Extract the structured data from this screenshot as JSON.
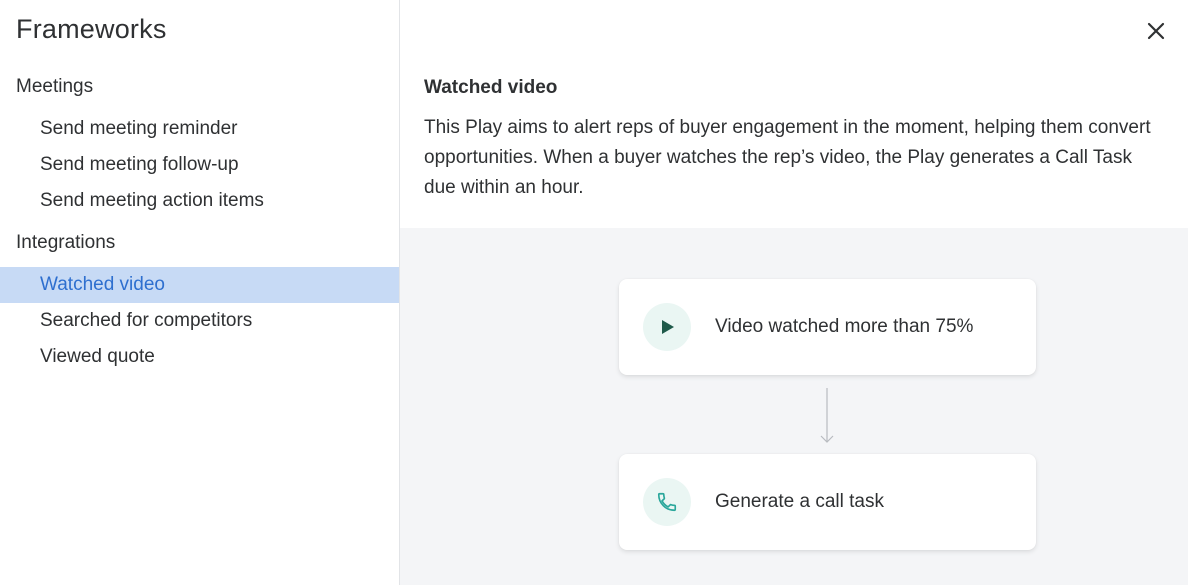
{
  "sidebar": {
    "title": "Frameworks",
    "sections": [
      {
        "header": "Meetings",
        "items": [
          {
            "label": "Send meeting reminder"
          },
          {
            "label": "Send meeting follow-up"
          },
          {
            "label": "Send meeting action items"
          }
        ]
      },
      {
        "header": "Integrations",
        "items": [
          {
            "label": "Watched video",
            "active": true
          },
          {
            "label": "Searched for competitors"
          },
          {
            "label": "Viewed quote"
          }
        ]
      }
    ]
  },
  "main": {
    "close_icon": "close-icon",
    "title": "Watched video",
    "description": "This Play aims to alert reps of buyer engagement in the moment, helping them convert opportunities. When a buyer watches the rep’s video, the Play generates a Call Task due within an hour.",
    "flow": [
      {
        "icon": "play-icon",
        "label": "Video watched more than 75%",
        "icon_color": "#1f5a4a"
      },
      {
        "icon": "phone-icon",
        "label": "Generate a call task",
        "icon_color": "#2aa79b"
      }
    ]
  },
  "colors": {
    "active_bg": "#c7daf5",
    "active_text": "#2e6fcf",
    "canvas_bg": "#f4f5f7",
    "icon_bg": "#eaf6f3"
  }
}
